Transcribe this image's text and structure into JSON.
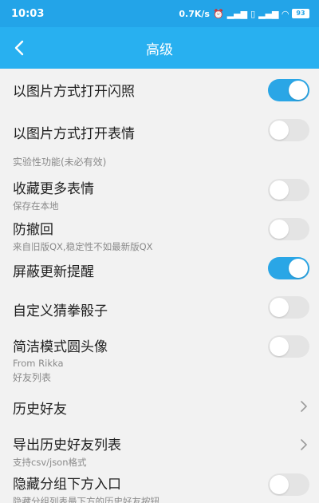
{
  "status": {
    "time": "10:03",
    "speed": "0.7K/s",
    "battery": "93"
  },
  "header": {
    "title": "高级"
  },
  "items": [
    {
      "label": "以图片方式打开闪照",
      "toggle": true
    },
    {
      "label": "以图片方式打开表情",
      "toggle": false
    },
    {
      "section": "实验性功能(未必有效)"
    },
    {
      "label": "收藏更多表情",
      "sub": "保存在本地",
      "toggle": false
    },
    {
      "label": "防撤回",
      "sub": "来自旧版QX,稳定性不如最新版QX",
      "toggle": false
    },
    {
      "label": "屏蔽更新提醒",
      "toggle": true
    },
    {
      "label": "自定义猜拳骰子",
      "toggle": false
    },
    {
      "label": "简洁模式圆头像",
      "sub": "From Rikka",
      "toggle": false
    },
    {
      "section": "好友列表"
    },
    {
      "label": "历史好友",
      "arrow": true
    },
    {
      "label": "导出历史好友列表",
      "sub": "支持csv/json格式",
      "arrow": true
    },
    {
      "label": "隐藏分组下方入口",
      "sub": "隐藏分组列表最下方的历史好友按钮",
      "toggle": false
    }
  ]
}
